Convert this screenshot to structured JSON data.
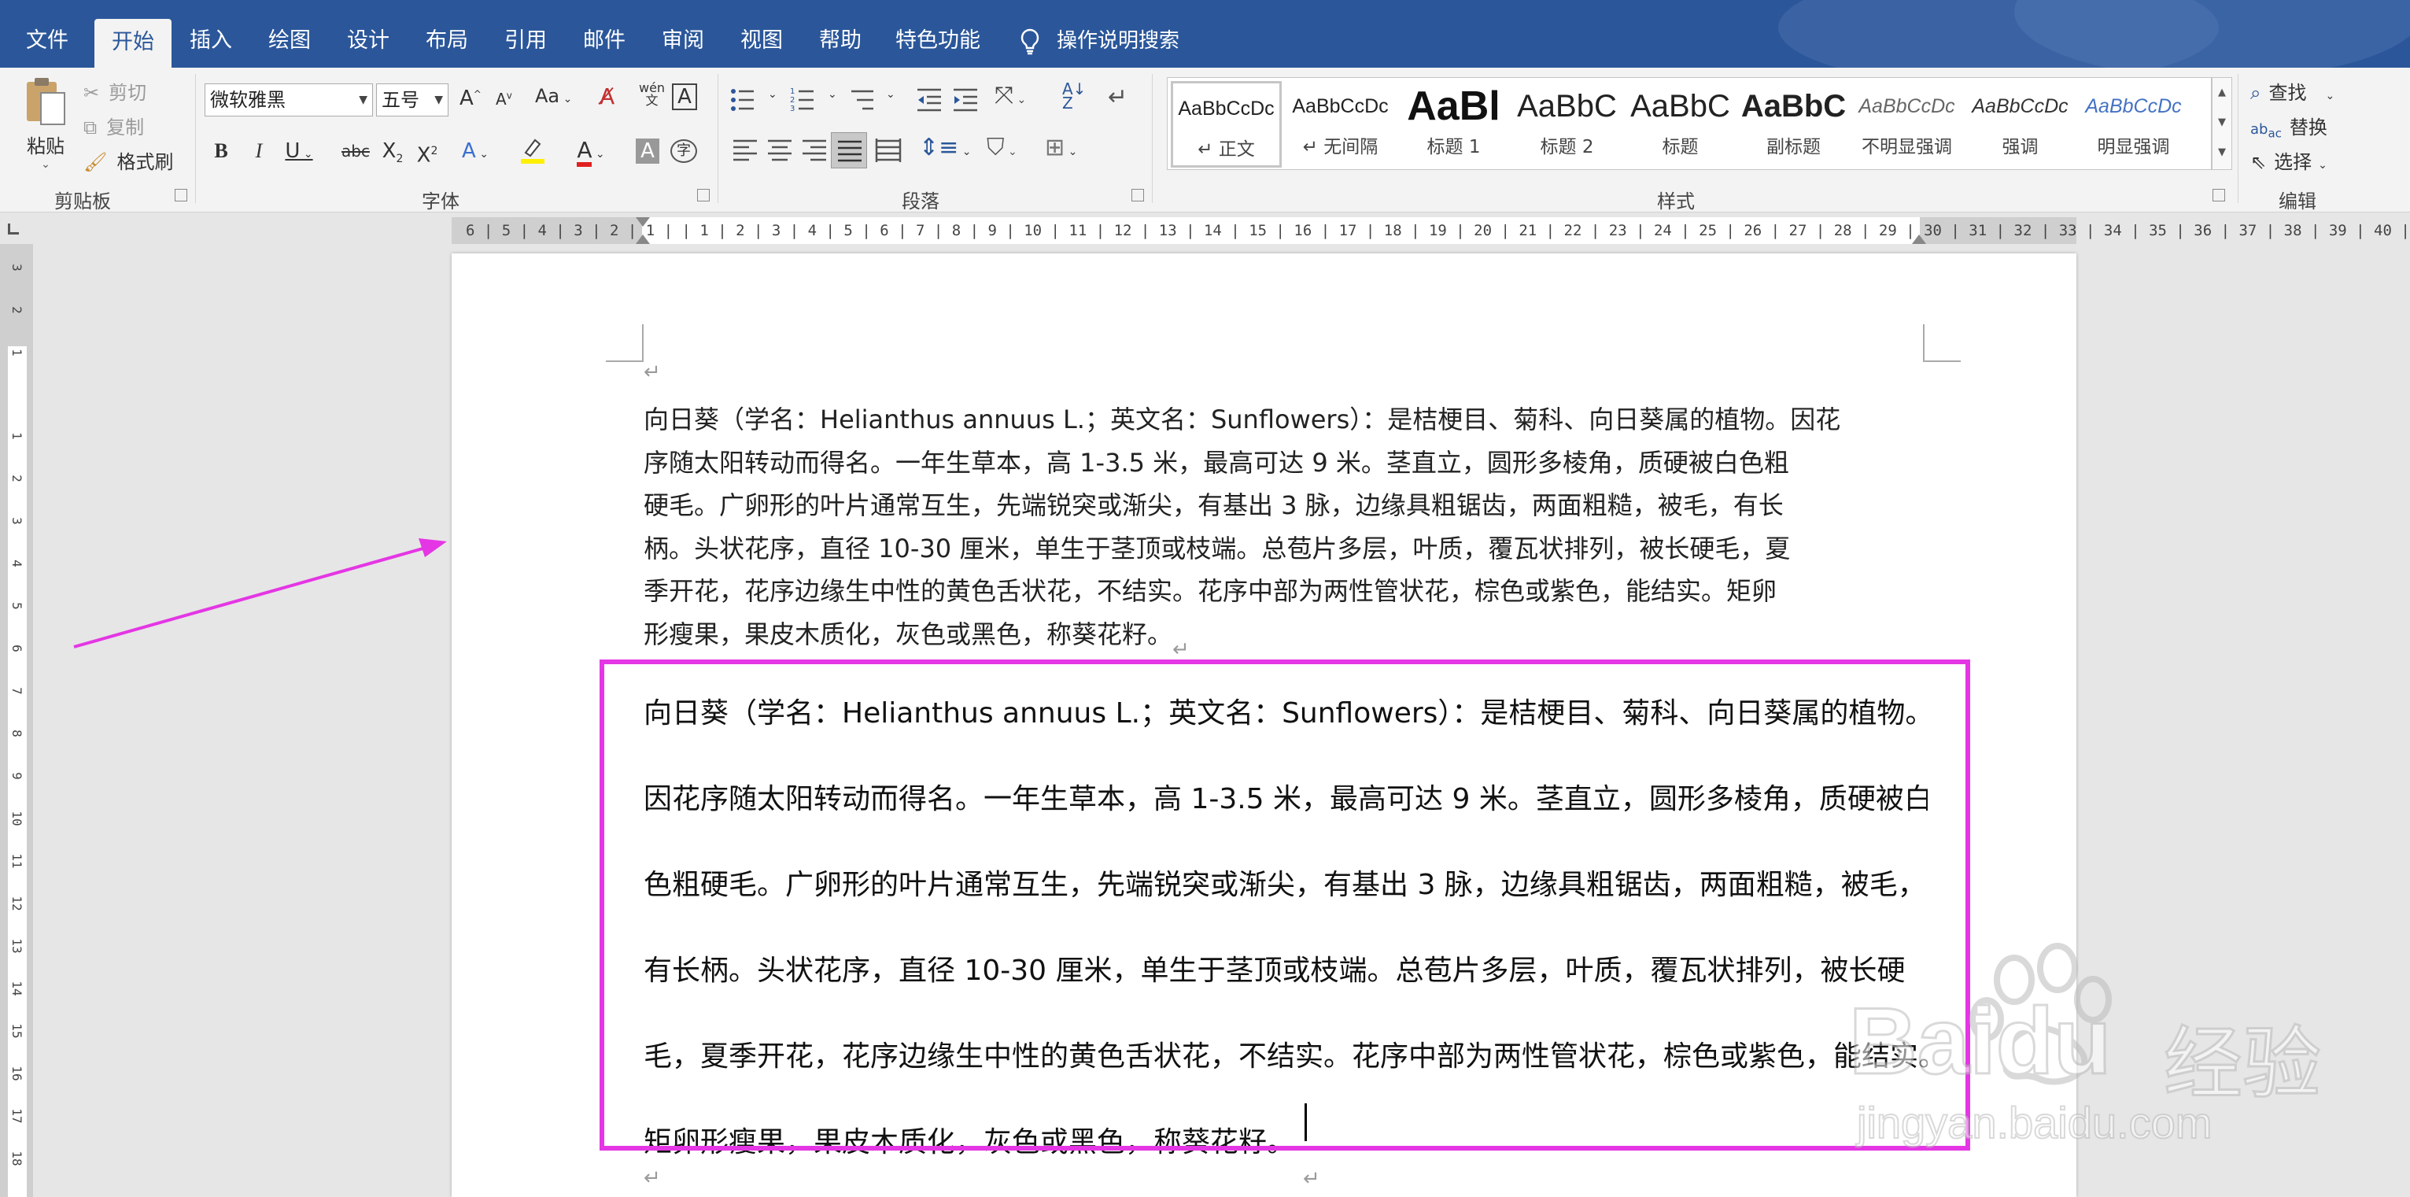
{
  "tabs": [
    "文件",
    "开始",
    "插入",
    "绘图",
    "设计",
    "布局",
    "引用",
    "邮件",
    "审阅",
    "视图",
    "帮助",
    "特色功能"
  ],
  "tell_me": "操作说明搜索",
  "clipboard": {
    "paste": "粘贴",
    "cut": "剪切",
    "copy": "复制",
    "format_painter": "格式刷",
    "group": "剪贴板"
  },
  "font": {
    "name": "微软雅黑",
    "size": "五号",
    "change_case": "Aa",
    "group": "字体"
  },
  "paragraph": {
    "group": "段落"
  },
  "styles": {
    "group": "样式",
    "items": [
      {
        "preview": "AaBbCcDc",
        "name": "正文",
        "mark": "↵ "
      },
      {
        "preview": "AaBbCcDc",
        "name": "无间隔",
        "mark": "↵ "
      },
      {
        "preview": "AaBl",
        "name": "标题 1",
        "mark": ""
      },
      {
        "preview": "AaBbC",
        "name": "标题 2",
        "mark": ""
      },
      {
        "preview": "AaBbC",
        "name": "标题",
        "mark": ""
      },
      {
        "preview": "AaBbC",
        "name": "副标题",
        "mark": ""
      },
      {
        "preview": "AaBbCcDc",
        "name": "不明显强调",
        "mark": ""
      },
      {
        "preview": "AaBbCcDc",
        "name": "强调",
        "mark": ""
      },
      {
        "preview": "AaBbCcDc",
        "name": "明显强调",
        "mark": ""
      }
    ]
  },
  "editing": {
    "find": "查找",
    "replace": "替换",
    "select": "选择",
    "group": "编辑"
  },
  "ruler": {
    "h": "6 | 5 | 4 | 3 | 2 | 1 |   | 1 | 2 | 3 | 4 | 5 | 6 | 7 | 8 | 9 | 10 | 11 | 12 | 13 | 14 | 15 | 16 | 17 | 18 | 19 | 20 | 21 | 22 | 23 | 24 | 25 | 26 | 27 | 28 | 29 | 30 | 31 | 32 | 33 | 34 | 35 | 36 | 37 | 38 | 39 | 40 | 41 | 42 | 43 | 44 |  45 | 46 | 47 | 48 | 49 |",
    "v": [
      "3",
      "2",
      "1",
      "",
      "1",
      "2",
      "3",
      "4",
      "5",
      "6",
      "7",
      "8",
      "9",
      "10",
      "11",
      "12",
      "13",
      "14",
      "15",
      "16",
      "17",
      "18"
    ]
  },
  "document": {
    "para1_lines": [
      "向日葵（学名：Helianthus annuus L.；英文名：Sunflowers）：是桔梗目、菊科、向日葵属的植物。因花",
      "序随太阳转动而得名。一年生草本，高 1-3.5 米，最高可达 9 米。茎直立，圆形多棱角，质硬被白色粗",
      "硬毛。广卵形的叶片通常互生，先端锐突或渐尖，有基出 3 脉，边缘具粗锯齿，两面粗糙，被毛，有长",
      "柄。头状花序，直径 10-30 厘米，单生于茎顶或枝端。总苞片多层，叶质，覆瓦状排列，被长硬毛，夏",
      "季开花，花序边缘生中性的黄色舌状花，不结实。花序中部为两性管状花，棕色或紫色，能结实。矩卵",
      "形瘦果，果皮木质化，灰色或黑色，称葵花籽。"
    ],
    "para2_lines": [
      "向日葵（学名：Helianthus annuus L.；英文名：Sunflowers）：是桔梗目、菊科、向日葵属的植物。",
      "因花序随太阳转动而得名。一年生草本，高 1-3.5 米，最高可达 9 米。茎直立，圆形多棱角，质硬被白",
      "色粗硬毛。广卵形的叶片通常互生，先端锐突或渐尖，有基出 3 脉，边缘具粗锯齿，两面粗糙，被毛，",
      "有长柄。头状花序，直径 10-30 厘米，单生于茎顶或枝端。总苞片多层，叶质，覆瓦状排列，被长硬",
      "毛，夏季开花，花序边缘生中性的黄色舌状花，不结实。花序中部为两性管状花，棕色或紫色，能结实。",
      "矩卵形瘦果，果皮木质化，灰色或黑色，称葵花籽。"
    ],
    "paragraph_mark": "↵"
  },
  "watermark": {
    "brand": "Baidu",
    "cn": "经验",
    "url": "jingyan.baidu.com"
  },
  "colors": {
    "titlebar": "#2b579a",
    "highlight_box": "#e436e4",
    "arrow": "#e436e4"
  }
}
